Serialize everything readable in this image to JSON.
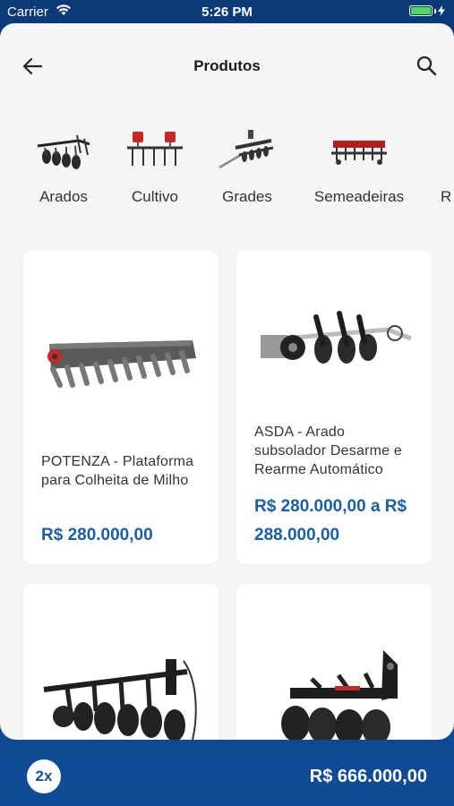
{
  "status_bar": {
    "carrier": "Carrier",
    "time": "5:26 PM"
  },
  "header": {
    "title": "Produtos"
  },
  "categories": [
    {
      "label": "Arados",
      "icon": "plow-icon"
    },
    {
      "label": "Cultivo",
      "icon": "cultivator-icon"
    },
    {
      "label": "Grades",
      "icon": "harrow-icon"
    },
    {
      "label": "Semeadeiras",
      "icon": "seeder-icon"
    },
    {
      "label": "R",
      "icon": ""
    }
  ],
  "products": [
    {
      "name": "POTENZA - Plataforma para Colheita de Milho",
      "price": "R$ 280.000,00",
      "icon": "corn-header-icon"
    },
    {
      "name": "ASDA - Arado subsolador Desarme e Rearme Automático",
      "price": "R$ 280.000,00 a R$ 288.000,00",
      "icon": "subsoiler-icon"
    },
    {
      "name": "",
      "price": "",
      "icon": "disc-plow-icon"
    },
    {
      "name": "",
      "price": "",
      "icon": "disc-harrow-icon"
    }
  ],
  "cart": {
    "quantity": "2x",
    "total": "R$ 666.000,00"
  },
  "colors": {
    "brand_blue": "#0f4c95",
    "price_blue": "#1b5fa3",
    "battery_green": "#4cd964"
  }
}
